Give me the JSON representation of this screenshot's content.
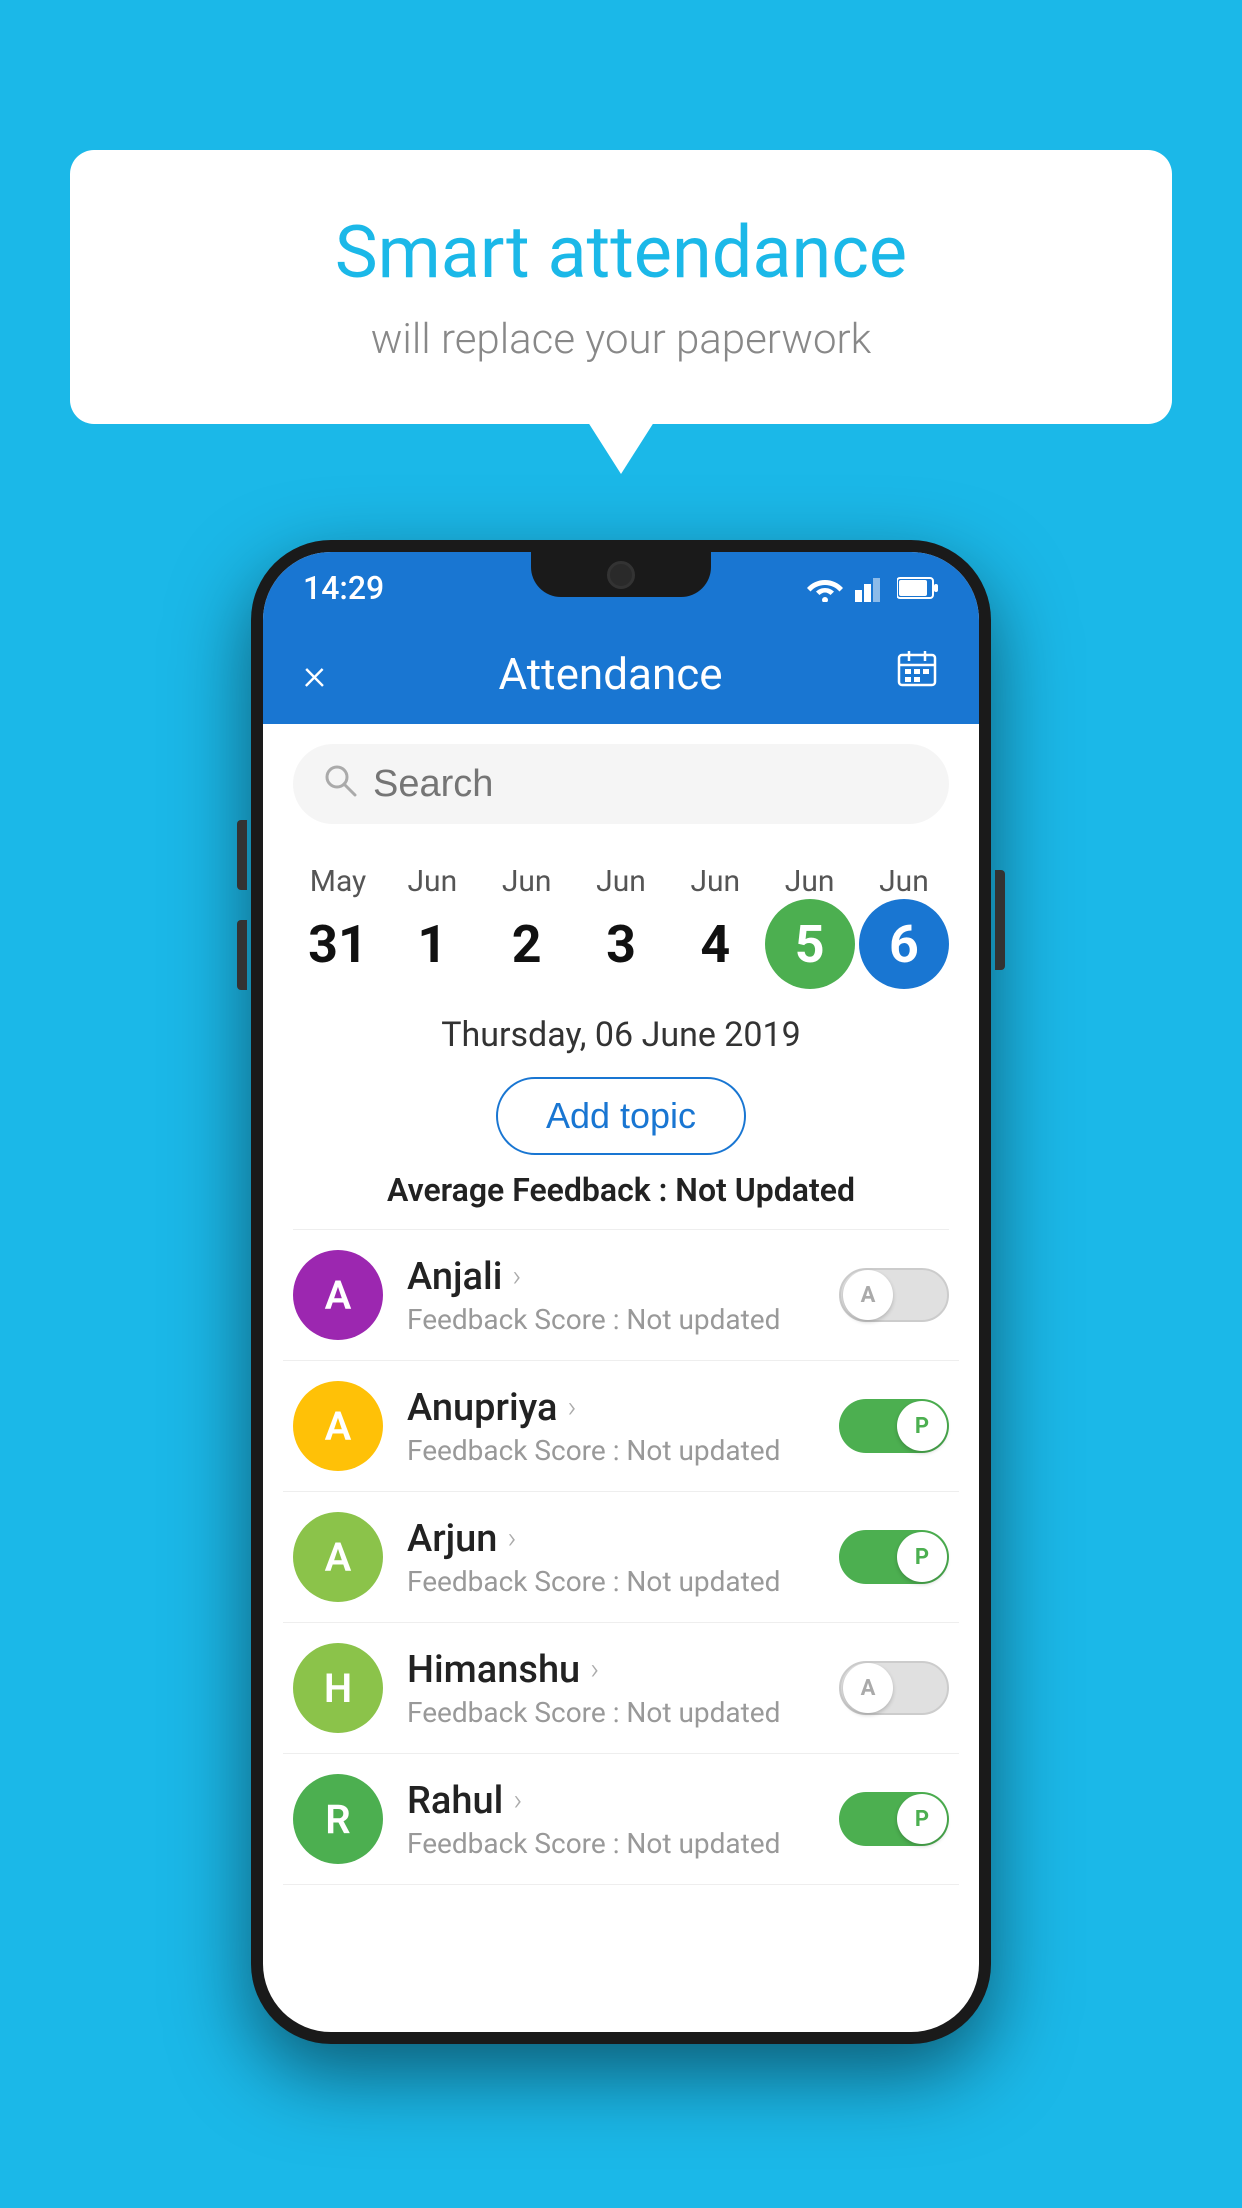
{
  "background": {
    "color": "#1BB8E8"
  },
  "speech_bubble": {
    "title": "Smart attendance",
    "subtitle": "will replace your paperwork"
  },
  "phone": {
    "status_bar": {
      "time": "14:29",
      "icons": [
        "wifi",
        "signal",
        "battery"
      ]
    },
    "header": {
      "title": "Attendance",
      "close_icon": "×",
      "calendar_icon": "📅"
    },
    "search": {
      "placeholder": "Search"
    },
    "dates": [
      {
        "month": "May",
        "day": "31",
        "style": "normal"
      },
      {
        "month": "Jun",
        "day": "1",
        "style": "normal"
      },
      {
        "month": "Jun",
        "day": "2",
        "style": "normal"
      },
      {
        "month": "Jun",
        "day": "3",
        "style": "normal"
      },
      {
        "month": "Jun",
        "day": "4",
        "style": "normal"
      },
      {
        "month": "Jun",
        "day": "5",
        "style": "green"
      },
      {
        "month": "Jun",
        "day": "6",
        "style": "blue"
      }
    ],
    "selected_date": "Thursday, 06 June 2019",
    "add_topic_label": "Add topic",
    "avg_feedback_label": "Average Feedback :",
    "avg_feedback_value": "Not Updated",
    "students": [
      {
        "name": "Anjali",
        "initial": "A",
        "avatar_color": "#9C27B0",
        "feedback_label": "Feedback Score :",
        "feedback_value": "Not updated",
        "toggle_state": "inactive",
        "toggle_label": "A"
      },
      {
        "name": "Anupriya",
        "initial": "A",
        "avatar_color": "#FFC107",
        "feedback_label": "Feedback Score :",
        "feedback_value": "Not updated",
        "toggle_state": "active",
        "toggle_label": "P"
      },
      {
        "name": "Arjun",
        "initial": "A",
        "avatar_color": "#8BC34A",
        "feedback_label": "Feedback Score :",
        "feedback_value": "Not updated",
        "toggle_state": "active",
        "toggle_label": "P"
      },
      {
        "name": "Himanshu",
        "initial": "H",
        "avatar_color": "#8BC34A",
        "feedback_label": "Feedback Score :",
        "feedback_value": "Not updated",
        "toggle_state": "inactive",
        "toggle_label": "A"
      },
      {
        "name": "Rahul",
        "initial": "R",
        "avatar_color": "#4CAF50",
        "feedback_label": "Feedback Score :",
        "feedback_value": "Not updated",
        "toggle_state": "active",
        "toggle_label": "P"
      }
    ]
  }
}
